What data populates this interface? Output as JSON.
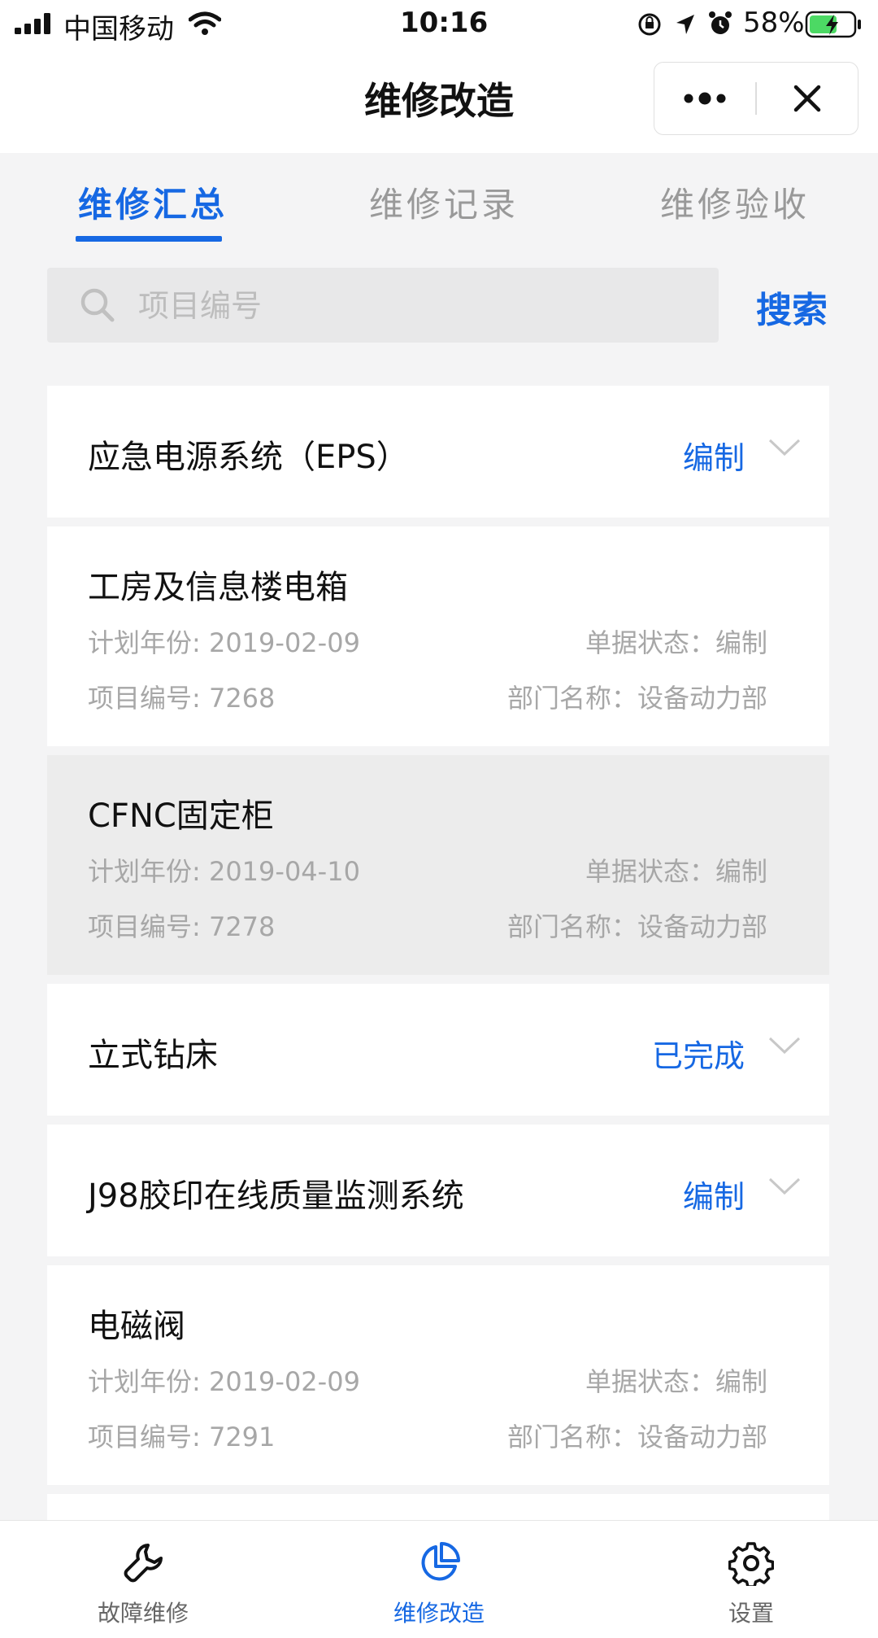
{
  "status_bar": {
    "carrier": "中国移动",
    "time": "10:16",
    "battery": "58%"
  },
  "nav": {
    "title": "维修改造"
  },
  "tabs": [
    {
      "label": "维修汇总",
      "active": true
    },
    {
      "label": "维修记录",
      "active": false
    },
    {
      "label": "维修验收",
      "active": false
    }
  ],
  "search": {
    "placeholder": "项目编号",
    "button_label": "搜索"
  },
  "items": [
    {
      "title": "应急电源系统（EPS）",
      "status": "编制"
    },
    {
      "title": "工房及信息楼电箱",
      "plan": "计划年份: 2019-02-09",
      "doc_status": "单据状态：编制",
      "code": "项目编号: 7268",
      "dept": "部门名称：设备动力部"
    },
    {
      "title": "CFNC固定柜",
      "plan": "计划年份: 2019-04-10",
      "doc_status": "单据状态：编制",
      "code": "项目编号: 7278",
      "dept": "部门名称：设备动力部"
    },
    {
      "title": "立式钻床",
      "status": "已完成"
    },
    {
      "title": "J98胶印在线质量监测系统",
      "status": "编制"
    },
    {
      "title": "电磁阀",
      "plan": "计划年份: 2019-02-09",
      "doc_status": "单据状态：编制",
      "code": "项目编号: 7291",
      "dept": "部门名称：设备动力部"
    }
  ],
  "tabbar": [
    {
      "label": "故障维修",
      "icon": "wrench-icon"
    },
    {
      "label": "维修改造",
      "icon": "pie-chart-icon",
      "active": true
    },
    {
      "label": "设置",
      "icon": "gear-icon"
    }
  ],
  "colors": {
    "accent": "#1668e3",
    "meta_text": "#a7a7a7",
    "background": "#f4f4f5"
  }
}
